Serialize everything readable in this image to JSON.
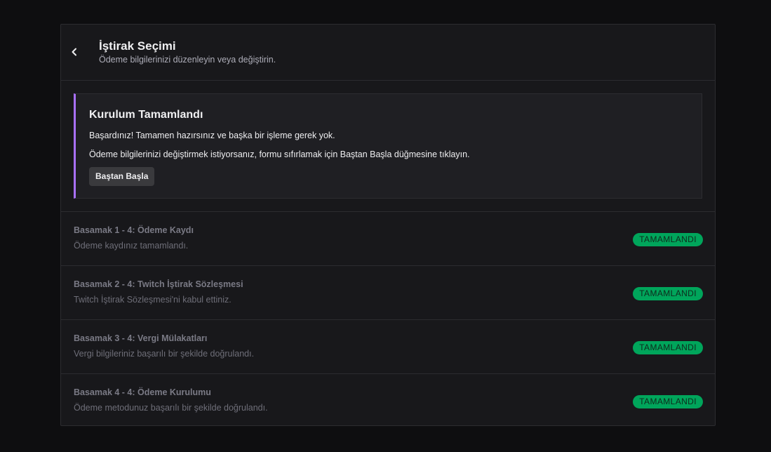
{
  "header": {
    "title": "İştirak Seçimi",
    "subtitle": "Ödeme bilgilerinizi düzenleyin veya değiştirin."
  },
  "notice": {
    "title": "Kurulum Tamamlandı",
    "line1": "Başardınız! Tamamen hazırsınız ve başka bir işleme gerek yok.",
    "line2": "Ödeme bilgilerinizi değiştirmek istiyorsanız, formu sıfırlamak için Baştan Başla düğmesine tıklayın.",
    "button_label": "Baştan Başla",
    "accent_color": "#a970ff"
  },
  "steps": [
    {
      "title": "Basamak 1 - 4: Ödeme Kaydı",
      "description": "Ödeme kaydınız tamamlandı.",
      "status": "TAMAMLANDI"
    },
    {
      "title": "Basamak 2 - 4: Twitch İştirak Sözleşmesi",
      "description": "Twitch İştirak Sözleşmesi'ni kabul ettiniz.",
      "status": "TAMAMLANDI"
    },
    {
      "title": "Basamak 3 - 4: Vergi Mülakatları",
      "description": "Vergi bilgileriniz başarılı bir şekilde doğrulandı.",
      "status": "TAMAMLANDI"
    },
    {
      "title": "Basamak 4 - 4: Ödeme Kurulumu",
      "description": "Ödeme metodunuz başarılı bir şekilde doğrulandı.",
      "status": "TAMAMLANDI"
    }
  ],
  "colors": {
    "background": "#0e0e10",
    "panel": "#18181b",
    "status_complete": "#00a55b"
  }
}
